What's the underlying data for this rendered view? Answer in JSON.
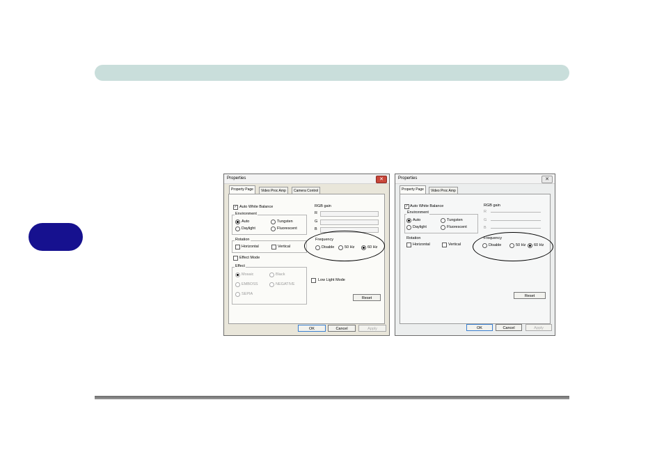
{
  "dialog1": {
    "title": "Properties",
    "tabs": [
      "Property Page",
      "Video Proc Amp",
      "Camera Control"
    ],
    "auto_white_balance": "Auto White Balance",
    "environment": {
      "label": "Environment",
      "auto": "Auto",
      "tungsten": "Tungsten",
      "daylight": "Daylight",
      "fluorescent": "Fluorescent"
    },
    "rgb_gain": {
      "label": "RGB gain",
      "r": "R",
      "g": "G",
      "b": "B"
    },
    "rotation": {
      "label": "Rotation",
      "horizontal": "Horizontal",
      "vertical": "Vertical"
    },
    "frequency": {
      "label": "Frequency",
      "disable": "Disable",
      "hz50": "50 Hz",
      "hz60": "60 Hz"
    },
    "effect_mode": "Effect Mode",
    "effect": {
      "label": "Effect",
      "mosaic": "Mosaic",
      "black": "Black",
      "emboss": "EMBOSS",
      "negative": "NEGATIVE",
      "sepia": "SEPIA"
    },
    "low_light_mode": "Low Light Mode",
    "reset": "Reset",
    "ok": "OK",
    "cancel": "Cancel",
    "apply": "Apply"
  },
  "dialog2": {
    "title": "Properties",
    "tabs": [
      "Property Page",
      "Video Proc Amp"
    ],
    "auto_white_balance": "Auto White Balance",
    "environment": {
      "label": "Environment",
      "auto": "Auto",
      "tungsten": "Tungsten",
      "daylight": "Daylight",
      "fluorescent": "Fluorescent"
    },
    "rgb_gain": {
      "label": "RGB gain",
      "r": "R",
      "g": "G",
      "b": "B"
    },
    "rotation": {
      "label": "Rotation",
      "horizontal": "Horizontal",
      "vertical": "Vertical"
    },
    "frequency": {
      "label": "Frequency",
      "disable": "Disable",
      "hz50": "50 Hz",
      "hz60": "60 Hz"
    },
    "reset": "Reset",
    "ok": "OK",
    "cancel": "Cancel",
    "apply": "Apply"
  },
  "colors": {
    "header_bar": "#c9dedb",
    "side_tab": "#16118f"
  }
}
